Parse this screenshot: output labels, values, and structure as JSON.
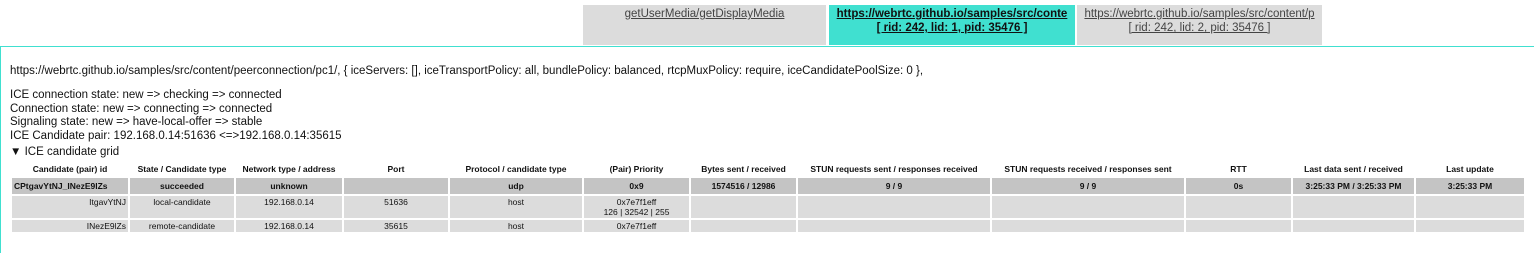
{
  "tabs": [
    {
      "line1": "getUserMedia/getDisplayMedia",
      "line2": ""
    },
    {
      "line1": "https://webrtc.github.io/samples/src/conte",
      "line2": "[ rid: 242, lid: 1, pid: 35476 ]"
    },
    {
      "line1": "https://webrtc.github.io/samples/src/content/p",
      "line2": "[ rid: 242, lid: 2, pid: 35476 ]"
    }
  ],
  "peer_connection": {
    "config_line": "https://webrtc.github.io/samples/src/content/peerconnection/pc1/, { iceServers: [], iceTransportPolicy: all, bundlePolicy: balanced, rtcpMuxPolicy: require, iceCandidatePoolSize: 0 },",
    "ice_connection_state": "ICE connection state: new => checking => connected",
    "connection_state": "Connection state: new => connecting => connected",
    "signaling_state": "Signaling state: new => have-local-offer => stable",
    "candidate_pair": "ICE Candidate pair: 192.168.0.14:51636 <=>192.168.0.14:35615",
    "grid_toggle": "▼ ICE candidate grid"
  },
  "grid": {
    "headers": [
      "Candidate (pair) id",
      "State / Candidate type",
      "Network type / address",
      "Port",
      "Protocol / candidate type",
      "(Pair) Priority",
      "Bytes sent / received",
      "STUN requests sent / responses received",
      "STUN requests received / responses sent",
      "RTT",
      "Last data sent / received",
      "Last update"
    ],
    "rows": [
      {
        "kind": "pair",
        "cells": [
          "CPtgavYtNJ_INezE9lZs",
          "succeeded",
          "unknown",
          "",
          "udp",
          "0x9",
          "1574516 / 12986",
          "9 / 9",
          "9 / 9",
          "0s",
          "3:25:33 PM / 3:25:33 PM",
          "3:25:33 PM"
        ]
      },
      {
        "kind": "candidate",
        "cells": [
          "ItgavYtNJ",
          "local-candidate",
          "192.168.0.14",
          "51636",
          "host",
          "0x7e7f1eff",
          "",
          "",
          "",
          "",
          "",
          ""
        ],
        "priority_detail": "126 | 32542 | 255"
      },
      {
        "kind": "candidate",
        "cells": [
          "INezE9lZs",
          "remote-candidate",
          "192.168.0.14",
          "35615",
          "host",
          "0x7e7f1eff",
          "",
          "",
          "",
          "",
          "",
          ""
        ]
      }
    ]
  }
}
